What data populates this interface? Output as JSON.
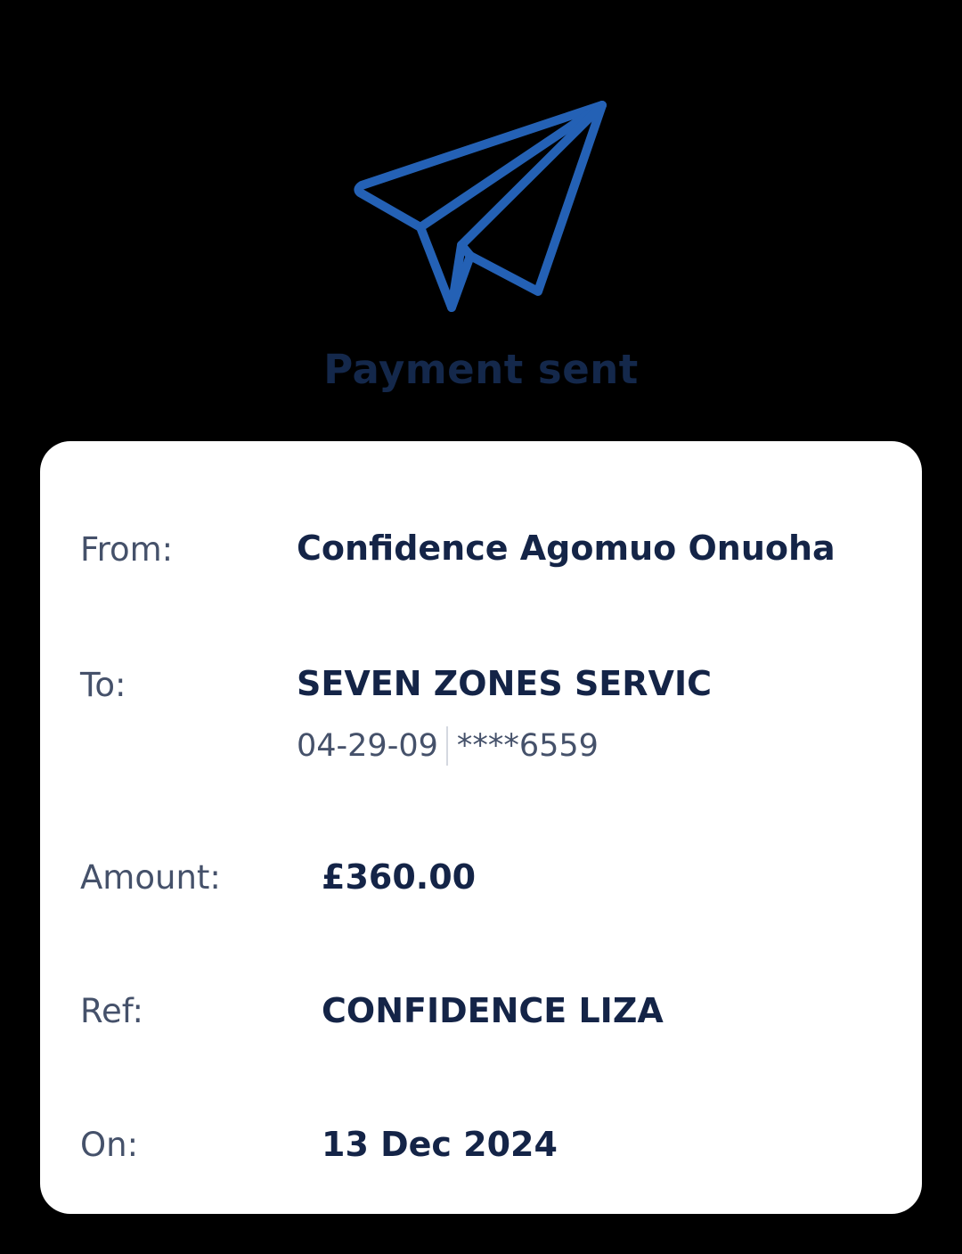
{
  "header": {
    "icon": "paper-plane-icon",
    "icon_color": "#2461b5",
    "title": "Payment sent",
    "title_color": "#14284b"
  },
  "details": {
    "from_label": "From:",
    "from_value": "Confidence Agomuo Onuoha",
    "to_label": "To:",
    "to_value": "SEVEN ZONES SERVIC",
    "sort_code": "04-29-09",
    "account_number": "****6559",
    "amount_label": "Amount:",
    "amount_value": "£360.00",
    "ref_label": "Ref:",
    "ref_value": "CONFIDENCE LIZA",
    "on_label": "On:",
    "on_value": "13 Dec 2024"
  }
}
